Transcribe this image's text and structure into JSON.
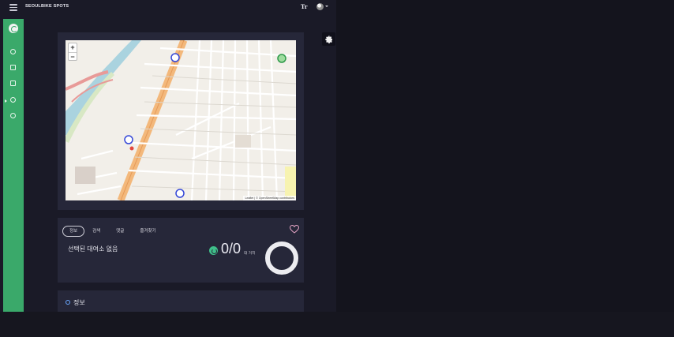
{
  "topbar": {
    "brand": "SEOULBIKE SPOTS",
    "font_size_icon_label": "Tr"
  },
  "sidebar": {
    "items": [
      {
        "name": "sidebar-item-dashboard",
        "icon": "pie-chart-icon"
      },
      {
        "name": "sidebar-item-list",
        "icon": "list-icon"
      },
      {
        "name": "sidebar-item-bike",
        "icon": "bike-icon",
        "active": true
      },
      {
        "name": "sidebar-item-settings",
        "icon": "gear-icon"
      },
      {
        "name": "sidebar-item-stats",
        "icon": "stats-icon"
      }
    ]
  },
  "map": {
    "zoom_in": "+",
    "zoom_out": "−",
    "attribution": "Leaflet | © OpenStreetMap contributors"
  },
  "station": {
    "tabs": [
      "정보",
      "검색",
      "댓글",
      "즐겨찾기"
    ],
    "active_tab": 0,
    "status": "선택된 대여소 없음",
    "count": "0/0",
    "count_unit": "대 거치"
  },
  "detail": {
    "title": "정보"
  },
  "colors": {
    "accent": "#3aa96a",
    "background": "#1a1a27",
    "card": "#262739"
  }
}
